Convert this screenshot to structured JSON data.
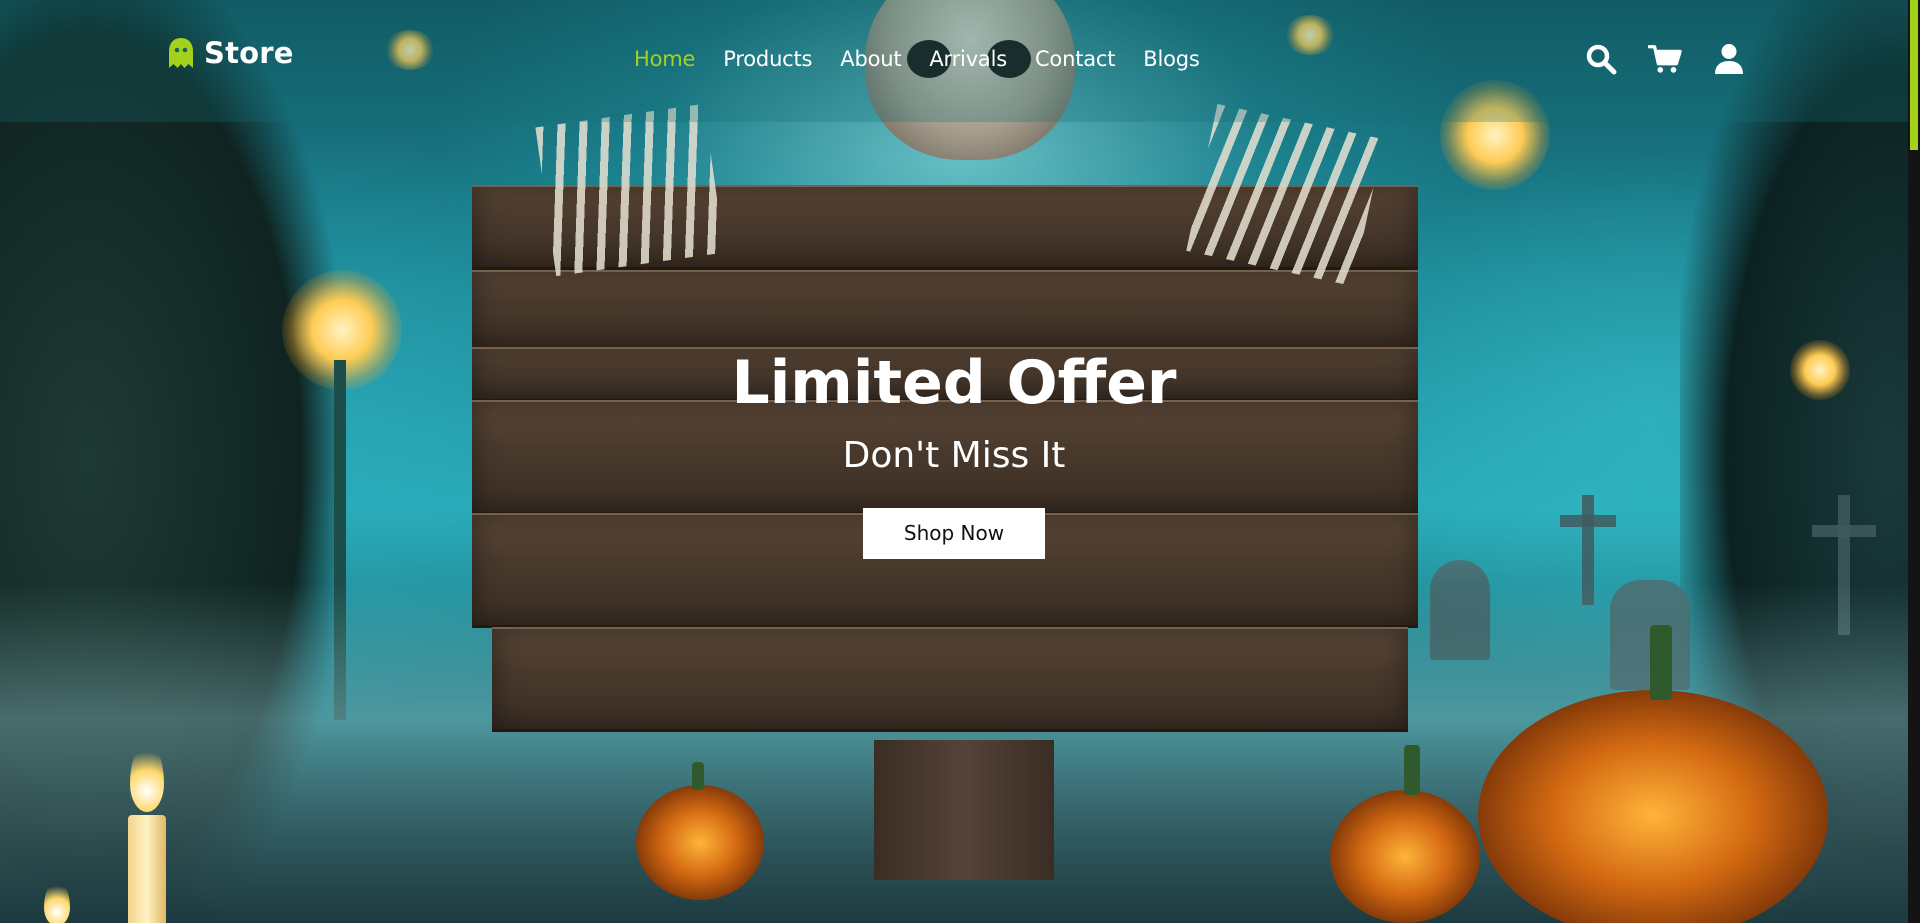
{
  "brand": {
    "name": "Store",
    "logo_icon": "ghost-icon",
    "accent_color": "#a4d21b"
  },
  "nav": {
    "items": [
      {
        "label": "Home",
        "active": true
      },
      {
        "label": "Products",
        "active": false
      },
      {
        "label": "About",
        "active": false
      },
      {
        "label": "Arrivals",
        "active": false
      },
      {
        "label": "Contact",
        "active": false
      },
      {
        "label": "Blogs",
        "active": false
      }
    ]
  },
  "header_icons": [
    "search-icon",
    "cart-icon",
    "user-icon"
  ],
  "hero": {
    "title": "Limited Offer",
    "subtitle": "Don't Miss It",
    "button_label": "Shop Now",
    "background": "halloween graveyard scene with wooden sign, skeleton, and jack-o-lanterns"
  }
}
